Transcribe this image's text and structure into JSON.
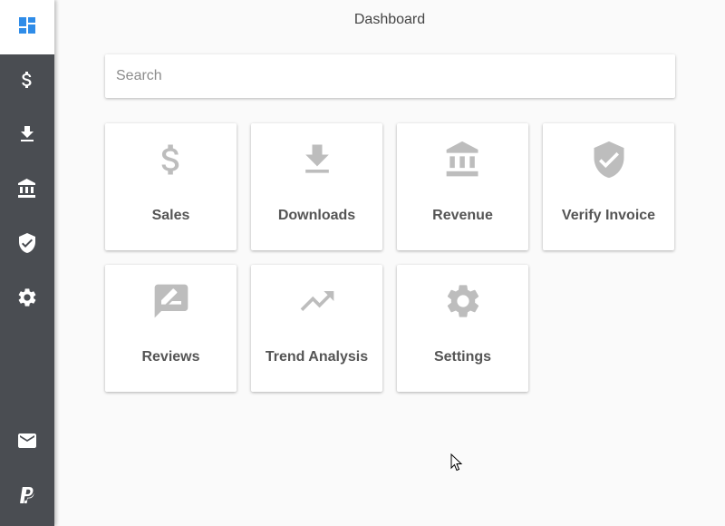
{
  "header": {
    "title": "Dashboard"
  },
  "search": {
    "placeholder": "Search",
    "value": ""
  },
  "sidebar": {
    "items": [
      {
        "name": "dashboard",
        "icon": "dashboard-icon",
        "active": true
      },
      {
        "name": "sales",
        "icon": "dollar-icon",
        "active": false
      },
      {
        "name": "downloads",
        "icon": "download-icon",
        "active": false
      },
      {
        "name": "revenue",
        "icon": "bank-icon",
        "active": false
      },
      {
        "name": "verify-invoice",
        "icon": "shield-check-icon",
        "active": false
      },
      {
        "name": "settings",
        "icon": "gear-icon",
        "active": false
      },
      {
        "name": "mail",
        "icon": "mail-icon",
        "active": false
      },
      {
        "name": "paypal",
        "icon": "paypal-icon",
        "active": false
      }
    ]
  },
  "cards": [
    {
      "label": "Sales",
      "icon": "dollar-icon"
    },
    {
      "label": "Downloads",
      "icon": "download-icon"
    },
    {
      "label": "Revenue",
      "icon": "bank-icon"
    },
    {
      "label": "Verify Invoice",
      "icon": "shield-check-icon"
    },
    {
      "label": "Reviews",
      "icon": "rate-review-icon"
    },
    {
      "label": "Trend Analysis",
      "icon": "trending-up-icon"
    },
    {
      "label": "Settings",
      "icon": "gear-icon"
    }
  ],
  "colors": {
    "sidebar_bg": "#4a4d52",
    "accent": "#2f8ce8",
    "card_icon": "#bdbdbd",
    "background": "#fafafa"
  }
}
